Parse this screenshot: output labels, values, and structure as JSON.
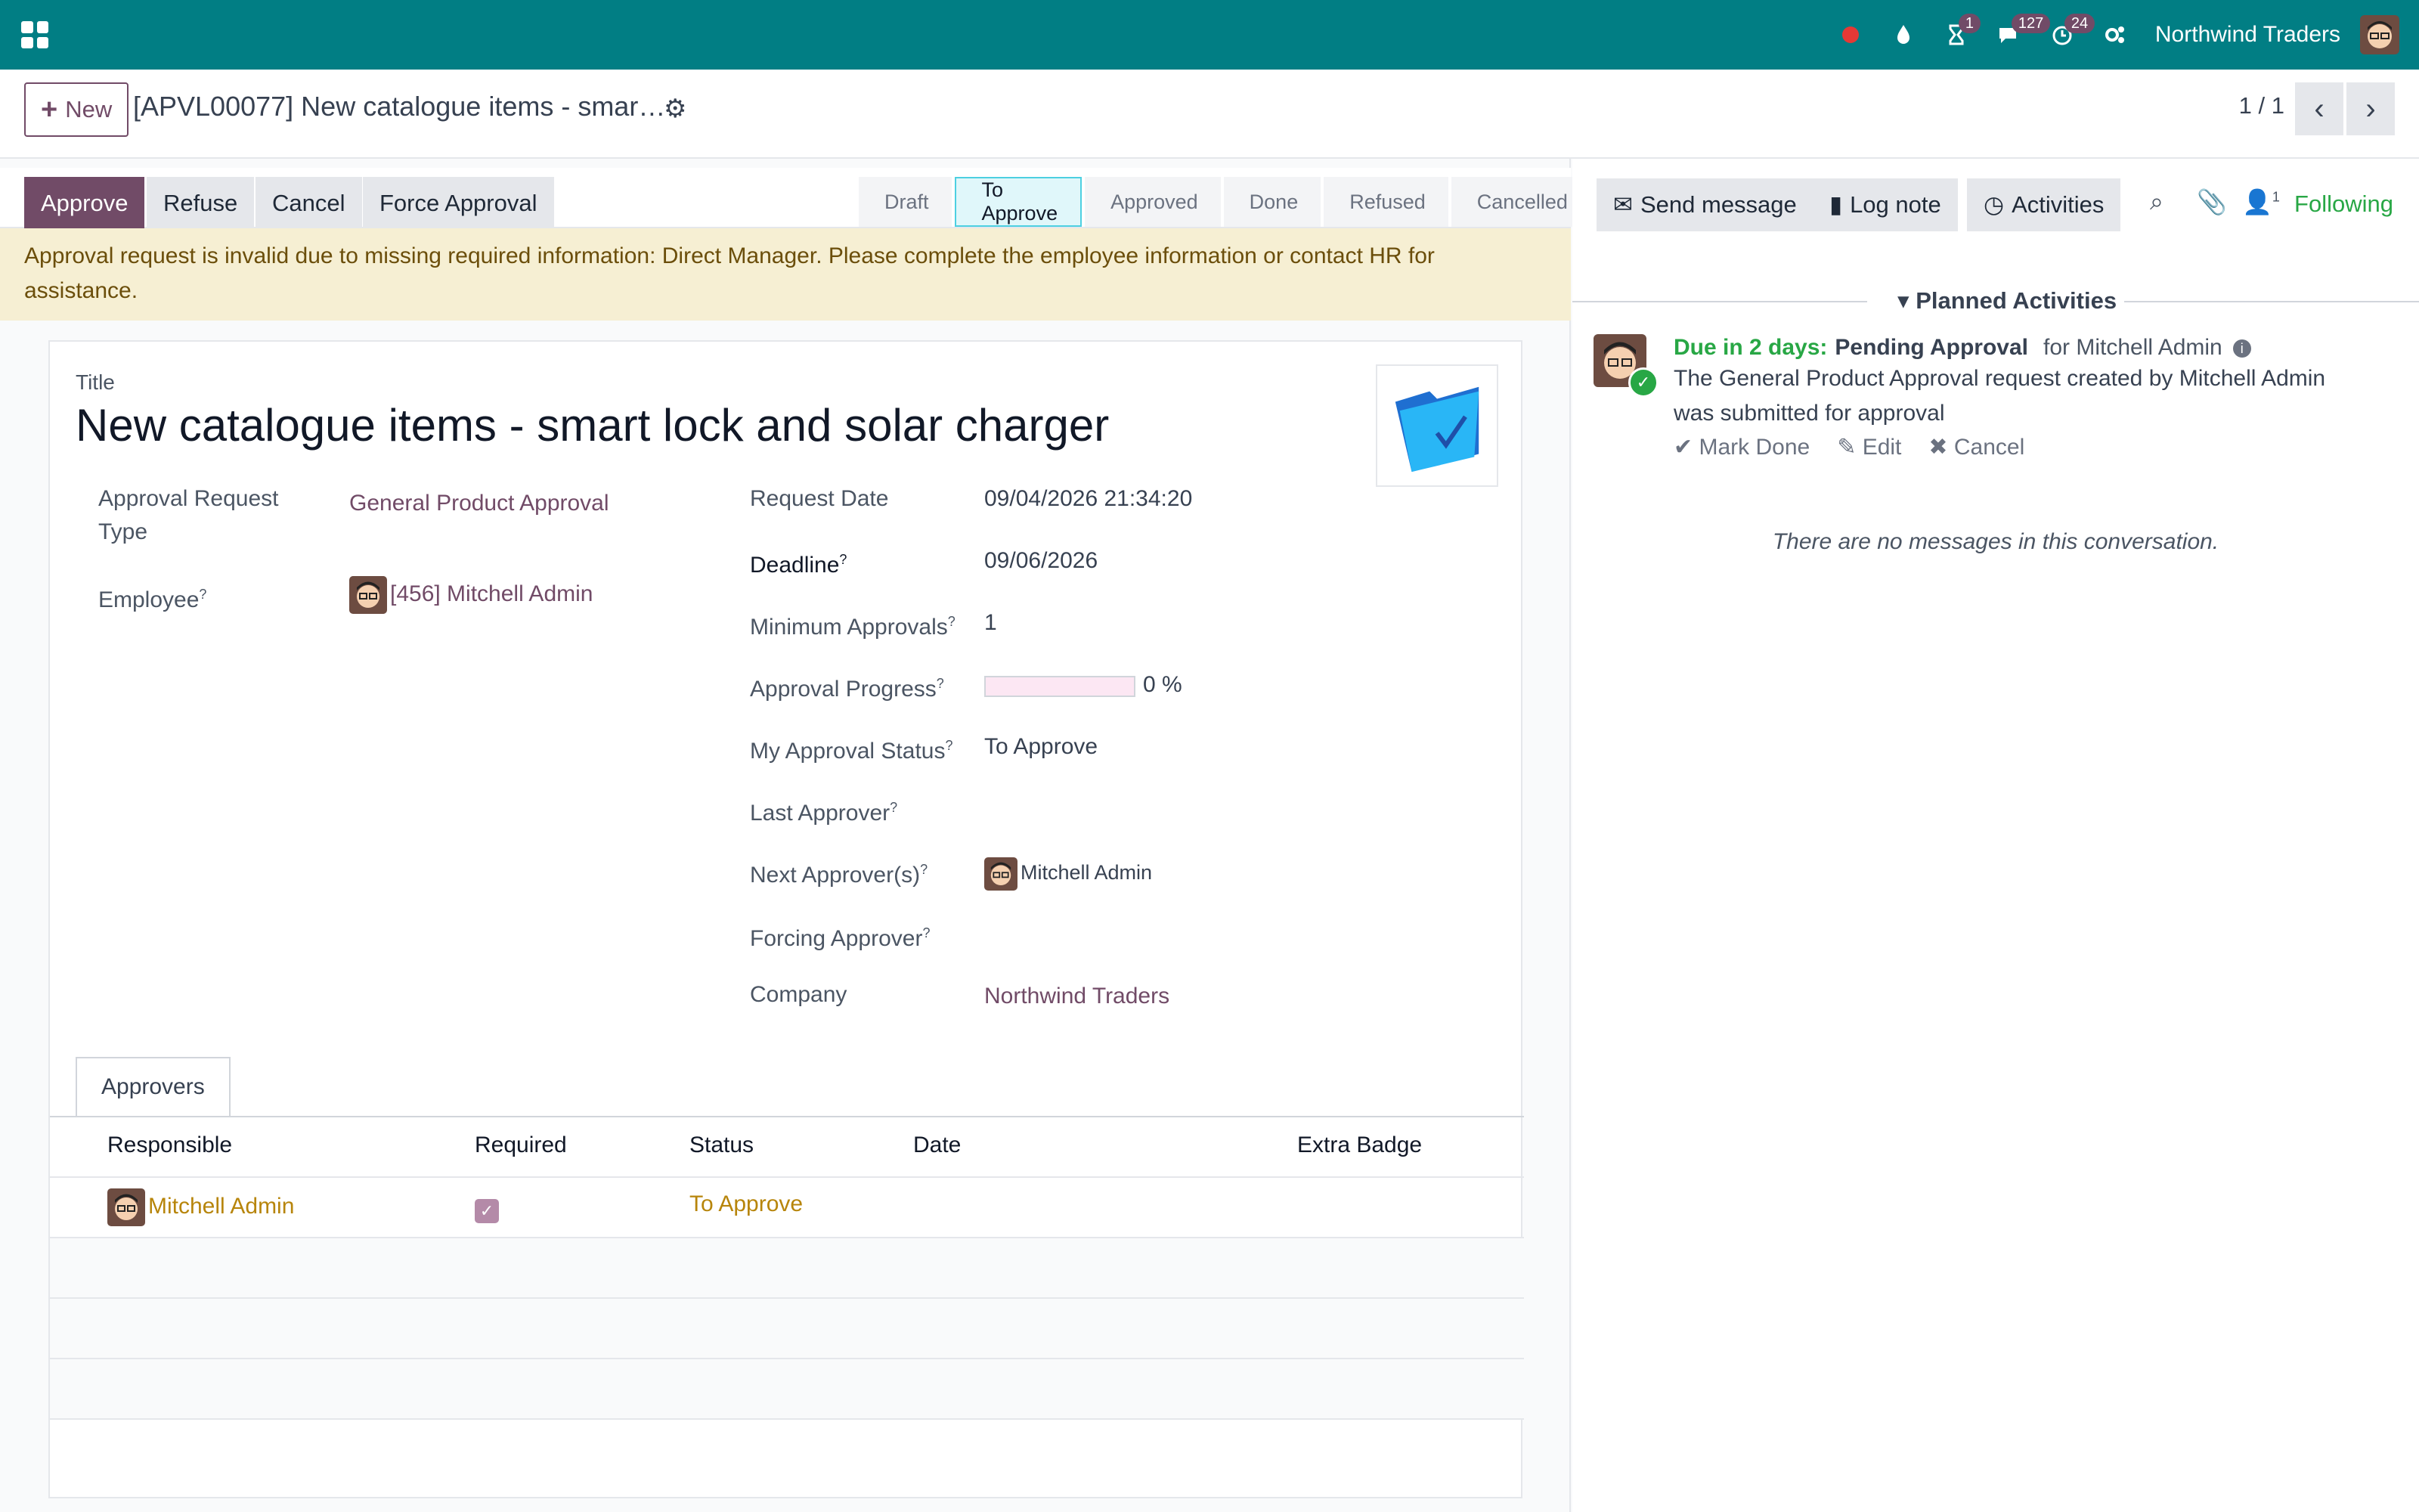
{
  "navbar": {
    "company": "Northwind Traders",
    "badges": {
      "activity": "1",
      "messages": "127",
      "timer": "24"
    },
    "colors": {
      "bar": "#017e84",
      "badge": "#714b67"
    }
  },
  "control": {
    "new_label": "New",
    "record_title": "[APVL00077] New catalogue items - smar…",
    "pager": "1 / 1"
  },
  "actions": {
    "approve": "Approve",
    "refuse": "Refuse",
    "cancel": "Cancel",
    "force": "Force Approval"
  },
  "stages": [
    "Draft",
    "To Approve",
    "Approved",
    "Done",
    "Refused",
    "Cancelled"
  ],
  "active_stage": "To Approve",
  "alert": "Approval request is invalid due to missing required information: Direct Manager. Please complete the employee information or contact HR for assistance.",
  "form": {
    "title_label": "Title",
    "title": "New catalogue items - smart lock and solar charger",
    "left": {
      "type_label": "Approval Request Type",
      "type_value": "General Product Approval",
      "employee_label": "Employee",
      "employee_value": "[456] Mitchell Admin"
    },
    "right": {
      "request_date_label": "Request Date",
      "request_date": "09/04/2026 21:34:20",
      "deadline_label": "Deadline",
      "deadline": "09/06/2026",
      "min_approvals_label": "Minimum Approvals",
      "min_approvals": "1",
      "progress_label": "Approval Progress",
      "progress_text": "0 %",
      "progress_value": 0,
      "my_status_label": "My Approval Status",
      "my_status": "To Approve",
      "last_approver_label": "Last Approver",
      "next_approvers_label": "Next Approver(s)",
      "next_approver": "Mitchell Admin",
      "forcing_label": "Forcing Approver",
      "company_label": "Company",
      "company": "Northwind Traders"
    },
    "tab": "Approvers",
    "table": {
      "headers": [
        "Responsible",
        "Required",
        "Status",
        "Date",
        "Extra Badge"
      ],
      "rows": [
        {
          "responsible": "Mitchell Admin",
          "required": true,
          "status": "To Approve",
          "date": "",
          "extra": ""
        }
      ]
    }
  },
  "chatter": {
    "send_message": "Send message",
    "log_note": "Log note",
    "activities": "Activities",
    "followers_count": "1",
    "following": "Following",
    "planned_title": "Planned Activities",
    "activity": {
      "due": "Due in 2 days:",
      "type": "Pending Approval",
      "for": "for Mitchell Admin",
      "description": "The General Product Approval request created by Mitchell Admin was submitted for approval",
      "mark_done": "Mark Done",
      "edit": "Edit",
      "cancel": "Cancel"
    },
    "empty": "There are no messages in this conversation."
  }
}
